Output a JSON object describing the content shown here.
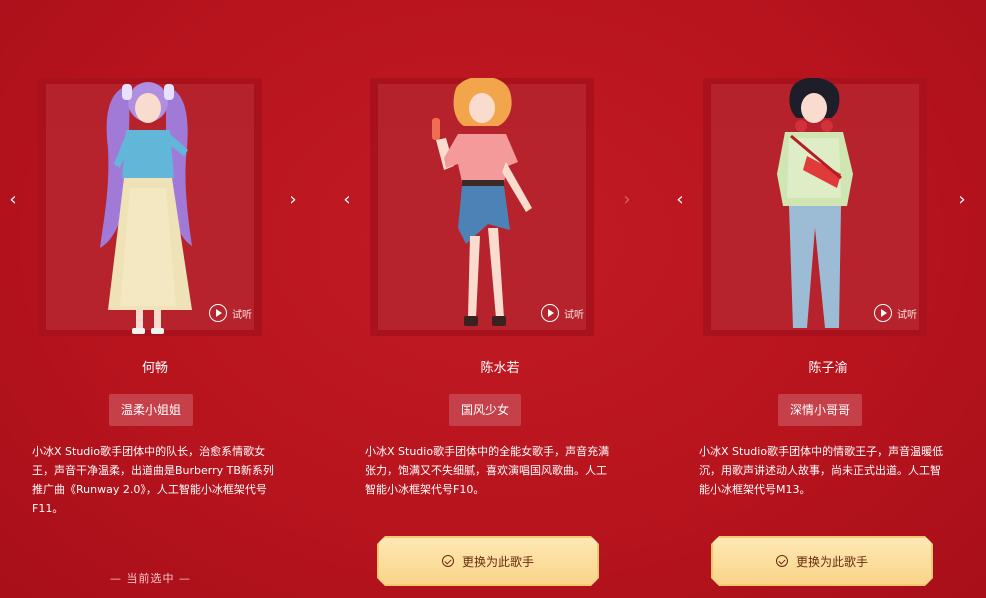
{
  "listen_label": "试听",
  "current_label": "— 当前选中 —",
  "swap_label": "更换为此歌手",
  "cards": [
    {
      "name": "何畅",
      "tag": "温柔小姐姐",
      "desc": "小冰X Studio歌手团体中的队长，治愈系情歌女王，声音干净温柔，出道曲是Burberry TB新系列推广曲《Runway 2.0》，人工智能小冰框架代号F11。"
    },
    {
      "name": "陈水若",
      "tag": "国风少女",
      "desc": "小冰X Studio歌手团体中的全能女歌手，声音充满张力，饱满又不失细腻，喜欢演唱国风歌曲。人工智能小冰框架代号F10。"
    },
    {
      "name": "陈子渝",
      "tag": "深情小哥哥",
      "desc": "小冰X Studio歌手团体中的情歌王子，声音温暖低沉，用歌声讲述动人故事，尚未正式出道。人工智能小冰框架代号M13。"
    }
  ],
  "icons": {
    "prev": "chevron-left-icon",
    "next": "chevron-right-icon",
    "play": "play-icon",
    "check": "check-circle-icon"
  },
  "colors": {
    "background": "#b8141e",
    "panel": "#a9121c",
    "tag": "#c6404a",
    "button": "#f9d489"
  }
}
